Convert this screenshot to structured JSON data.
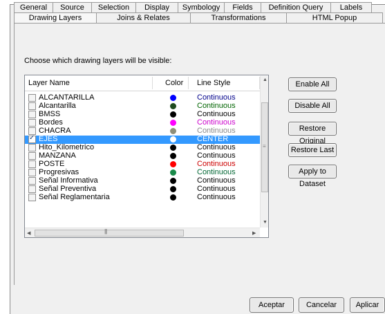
{
  "tabs_row1": [
    "General",
    "Source",
    "Selection",
    "Display",
    "Symbology",
    "Fields",
    "Definition Query",
    "Labels"
  ],
  "tabs_row2": [
    "Drawing Layers",
    "Joins & Relates",
    "Transformations",
    "HTML Popup"
  ],
  "active_tab": "Drawing Layers",
  "instruction": "Choose which drawing layers will be visible:",
  "columns": {
    "name": "Layer Name",
    "color": "Color",
    "style": "Line Style"
  },
  "layers": [
    {
      "name": "ALCANTARILLA",
      "color": "#0000ff",
      "style": "Continuous",
      "style_color": "#00008b",
      "checked": false,
      "selected": false
    },
    {
      "name": "Alcantarilla",
      "color": "#1f4b1f",
      "style": "Continuous",
      "style_color": "#006400",
      "checked": false,
      "selected": false
    },
    {
      "name": "BMSS",
      "color": "#000000",
      "style": "Continuous",
      "style_color": "#000000",
      "checked": false,
      "selected": false
    },
    {
      "name": "Bordes",
      "color": "#ff00ff",
      "style": "Continuous",
      "style_color": "#cc00cc",
      "checked": false,
      "selected": false
    },
    {
      "name": "CHACRA",
      "color": "#8f8f7a",
      "style": "Continuous",
      "style_color": "#8a8a8a",
      "checked": false,
      "selected": false
    },
    {
      "name": "EJES",
      "color": "#ffffff",
      "style": "CENTER",
      "style_color": "#ffffff",
      "checked": true,
      "selected": true
    },
    {
      "name": "Hito_Kilometrico",
      "color": "#000000",
      "style": "Continuous",
      "style_color": "#000000",
      "checked": false,
      "selected": false
    },
    {
      "name": "MANZANA",
      "color": "#000000",
      "style": "Continuous",
      "style_color": "#000000",
      "checked": false,
      "selected": false
    },
    {
      "name": "POSTE",
      "color": "#ff0000",
      "style": "Continuous",
      "style_color": "#cc0000",
      "checked": false,
      "selected": false
    },
    {
      "name": "Progresivas",
      "color": "#1a8a4a",
      "style": "Continuous",
      "style_color": "#006633",
      "checked": false,
      "selected": false
    },
    {
      "name": "Señal Informativa",
      "color": "#000000",
      "style": "Continuous",
      "style_color": "#000000",
      "checked": false,
      "selected": false
    },
    {
      "name": "Señal Preventiva",
      "color": "#000000",
      "style": "Continuous",
      "style_color": "#000000",
      "checked": false,
      "selected": false
    },
    {
      "name": "Señal Reglamentaria",
      "color": "#000000",
      "style": "Continuous",
      "style_color": "#000000",
      "checked": false,
      "selected": false
    }
  ],
  "side_buttons": [
    "Enable All",
    "Disable All",
    "Restore Original",
    "Restore Last",
    "Apply to Dataset"
  ],
  "bottom_buttons": [
    "Aceptar",
    "Cancelar",
    "Aplicar"
  ],
  "colors": {
    "selection": "#3399ff",
    "dialog_bg": "#f0f0f0"
  }
}
